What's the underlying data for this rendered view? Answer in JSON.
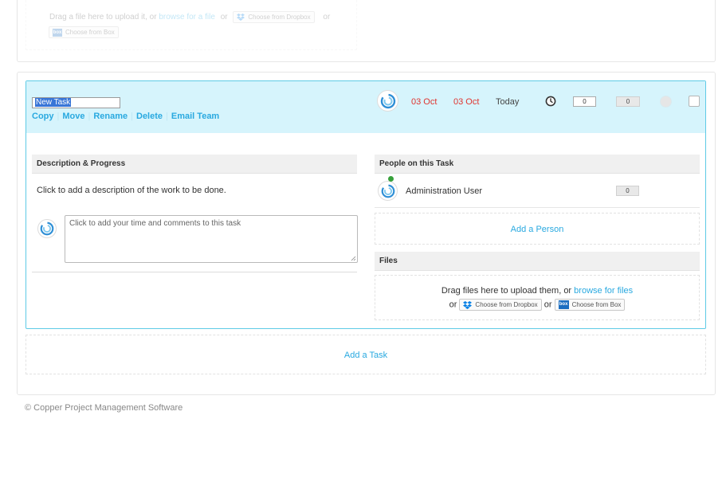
{
  "top_upload": {
    "drag_text": "Drag a file here to upload it, or",
    "browse_link": "browse for a file",
    "or1": "or",
    "dropbox_label": "Choose from Dropbox",
    "or2": "or",
    "box_label": "Choose from Box"
  },
  "task": {
    "name_value": "New Task",
    "actions": [
      "Copy",
      "Move",
      "Rename",
      "Delete",
      "Email Team"
    ],
    "start_date": "03 Oct",
    "due_date": "03 Oct",
    "today_label": "Today",
    "time_value": "0",
    "hours_value": "0",
    "date_color": "#e0342f"
  },
  "description": {
    "header": "Description & Progress",
    "placeholder_text": "Click to add a description of the work to be done.",
    "comment_placeholder": "Click to add your time and comments to this task"
  },
  "people": {
    "header": "People on this Task",
    "members": [
      {
        "name": "Administration User",
        "hours": "0"
      }
    ],
    "add_label": "Add a Person"
  },
  "files": {
    "header": "Files",
    "drag_text": "Drag files here to upload them, or",
    "browse_link": "browse for files",
    "or1": "or",
    "dropbox_label": "Choose from Dropbox",
    "or2": "or",
    "box_label": "Choose from Box"
  },
  "add_task_label": "Add a Task",
  "footer": "© Copper Project Management Software",
  "colors": {
    "accent": "#29a9e0",
    "task_header_bg": "#d6f4fc",
    "task_border": "#5ecbe6"
  }
}
